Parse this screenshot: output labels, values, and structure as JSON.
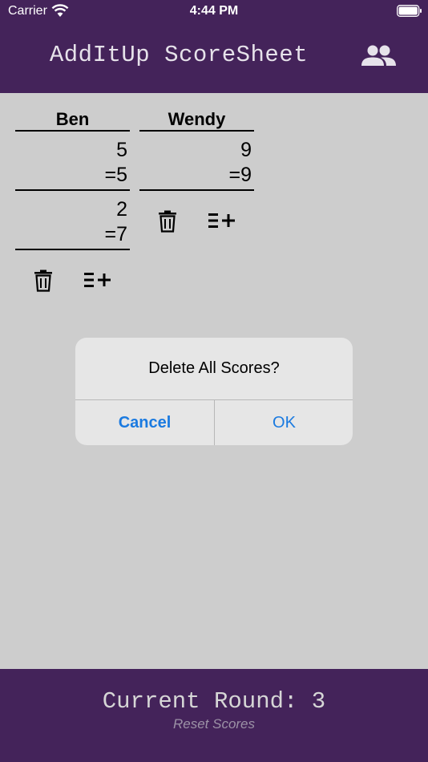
{
  "status_bar": {
    "carrier": "Carrier",
    "time": "4:44 PM"
  },
  "header": {
    "title": "AddItUp ScoreSheet",
    "players_icon": "people-icon"
  },
  "players": [
    {
      "name": "Ben",
      "entries": [
        {
          "score": "5",
          "total": "=5"
        },
        {
          "score": "2",
          "total": "=7"
        }
      ]
    },
    {
      "name": "Wendy",
      "entries": [
        {
          "score": "9",
          "total": "=9"
        }
      ]
    }
  ],
  "column_actions": {
    "delete_icon": "trash-icon",
    "add_icon": "add-score-icon"
  },
  "dialog": {
    "title": "Delete All Scores?",
    "cancel_label": "Cancel",
    "ok_label": "OK"
  },
  "footer": {
    "round_label": "Current Round: 3",
    "reset_label": "Reset Scores"
  },
  "colors": {
    "header_bg": "#44235a",
    "content_bg": "#cdcdcd",
    "dialog_bg": "#e6e6e6",
    "link_blue": "#1a7ae0"
  }
}
